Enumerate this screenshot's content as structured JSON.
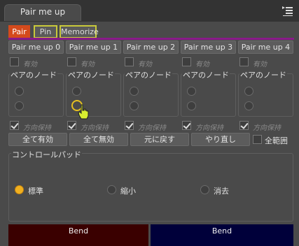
{
  "window": {
    "title": "Pair me up",
    "menu_icon": "panel-menu-icon"
  },
  "tabs": [
    {
      "label": "Pair",
      "active": true
    },
    {
      "label": "Pin",
      "active": false
    },
    {
      "label": "Memorize",
      "active": false
    }
  ],
  "accent_color": "#8a1a8a",
  "pair_buttons": [
    "Pair me up 0",
    "Pair me up 1",
    "Pair me up 2",
    "Pair me up 3",
    "Pair me up 4"
  ],
  "enable_label": "有効",
  "node_group_label": "ペアのノード",
  "direction_keep_label": "方向保持",
  "action_buttons": {
    "all_enable": "全て有効",
    "all_disable": "全て無効",
    "revert": "元に戻す",
    "redo": "やり直し"
  },
  "all_range_label": "全範囲",
  "control_pad": {
    "label": "コントロールパッド",
    "options": [
      {
        "label": "標準",
        "selected": true
      },
      {
        "label": "縮小",
        "selected": false
      },
      {
        "label": "消去",
        "selected": false
      }
    ]
  },
  "bend": [
    {
      "label": "Bend",
      "color": "#3a0000"
    },
    {
      "label": "Bend",
      "color": "#00003a"
    }
  ]
}
